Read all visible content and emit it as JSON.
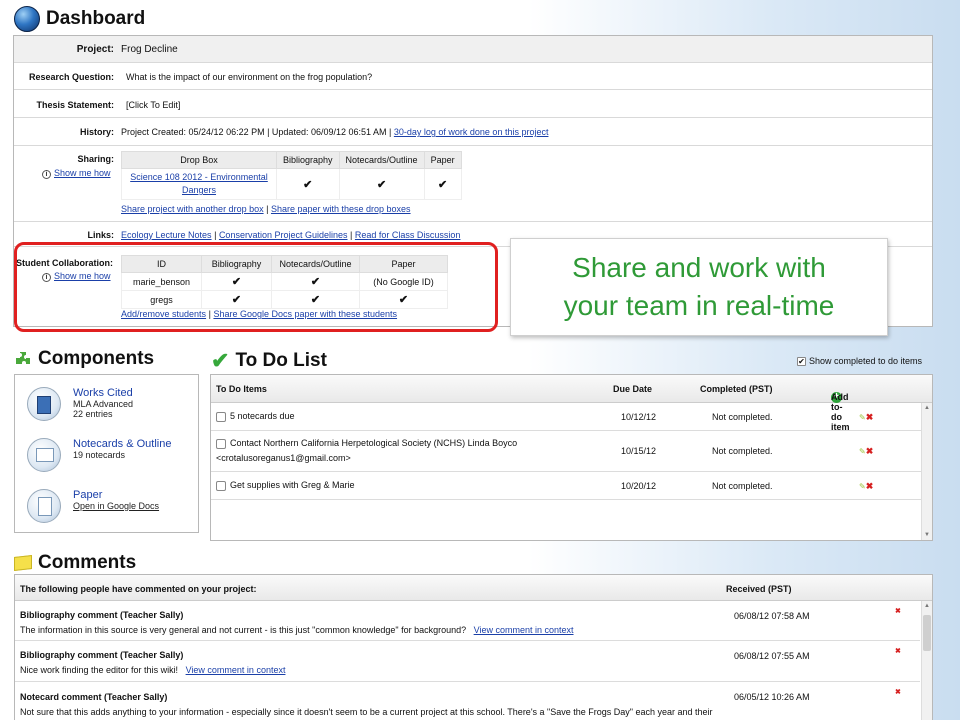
{
  "header": {
    "title": "Dashboard"
  },
  "project": {
    "project_label": "Project:",
    "project_value": "Frog Decline",
    "rq_label": "Research Question:",
    "rq_value": "What is the impact of our environment on the frog population?",
    "thesis_label": "Thesis Statement:",
    "thesis_value": "[Click To Edit]",
    "history_label": "History:",
    "history_text": "Project Created: 05/24/12 06:22 PM | Updated: 06/09/12 06:51 AM |",
    "history_link": "30-day log of work done on this project",
    "sharing_label": "Sharing:",
    "show_me_how": "Show me how",
    "sharing_table": {
      "headers": [
        "Drop Box",
        "Bibliography",
        "Notecards/Outline",
        "Paper"
      ],
      "row_link_line1": "Science 108 2012 - Environmental",
      "row_link_line2": "Dangers",
      "checks": [
        "✔",
        "✔",
        "✔"
      ]
    },
    "share_link_1": "Share project with another drop box",
    "share_link_2": "Share paper with these drop boxes",
    "sep": "|",
    "links_label": "Links:",
    "links": [
      "Ecology Lecture Notes",
      "Conservation Project Guidelines",
      "Read for Class Discussion"
    ],
    "collab_label": "Student Collaboration:",
    "collab_table": {
      "headers": [
        "ID",
        "Bibliography",
        "Notecards/Outline",
        "Paper"
      ],
      "rows": [
        {
          "id": "marie_benson",
          "bib": "✔",
          "notes": "✔",
          "paper": "(No Google ID)"
        },
        {
          "id": "gregs",
          "bib": "✔",
          "notes": "✔",
          "paper": "✔"
        }
      ]
    },
    "collab_link_1": "Add/remove students",
    "collab_link_2": "Share Google Docs paper with these students"
  },
  "callout": {
    "line1": "Share and work with",
    "line2": "your team in real-time"
  },
  "components": {
    "title": "Components",
    "items": [
      {
        "title": "Works Cited",
        "sub1": "MLA Advanced",
        "sub2": "22 entries"
      },
      {
        "title": "Notecards & Outline",
        "sub1": "19 notecards"
      },
      {
        "title": "Paper",
        "link": "Open in Google Docs"
      }
    ]
  },
  "todo": {
    "title": "To Do List",
    "show_completed": "Show completed to do items",
    "headers": {
      "items": "To Do Items",
      "due": "Due Date",
      "completed": "Completed (PST)",
      "add": "Add to-do item"
    },
    "rows": [
      {
        "text": "5 notecards due",
        "text2": "",
        "due": "10/12/12",
        "status": "Not completed."
      },
      {
        "text": "Contact Northern California Herpetological Society (NCHS) Linda Boyco",
        "text2": "<crotalusoreganus1@gmail.com>",
        "due": "10/15/12",
        "status": "Not completed."
      },
      {
        "text": "Get supplies with Greg & Marie",
        "text2": "",
        "due": "10/20/12",
        "status": "Not completed."
      }
    ]
  },
  "comments": {
    "title": "Comments",
    "header_left": "The following people have commented on your project:",
    "header_right": "Received (PST)",
    "rows": [
      {
        "title": "Bibliography comment (Teacher Sally)",
        "text": "The information in this source is very general and not current - is this just \"common knowledge\" for background?",
        "link": "View comment in context",
        "date": "06/08/12 07:58 AM"
      },
      {
        "title": "Bibliography comment (Teacher Sally)",
        "text": "Nice work finding the editor for this wiki!",
        "link": "View comment in context",
        "date": "06/08/12 07:55 AM"
      },
      {
        "title": "Notecard comment (Teacher Sally)",
        "text": "Not sure that this adds anything to your information - especially since it doesn't seem to be a current project at this school. There's a \"Save the Frogs Day\" each year and their",
        "link": "",
        "date": "06/05/12 10:26 AM"
      }
    ]
  }
}
